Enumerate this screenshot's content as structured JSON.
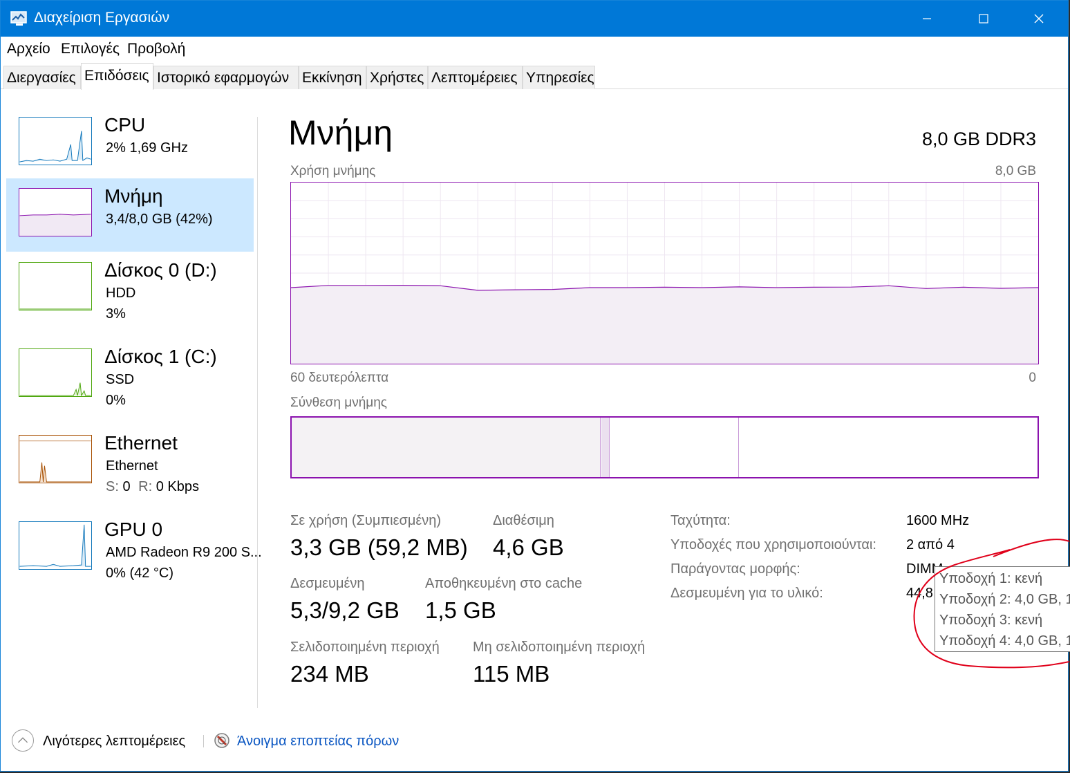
{
  "window": {
    "title": "Διαχείριση Εργασιών"
  },
  "menu": [
    "Αρχείο",
    "Επιλογές",
    "Προβολή"
  ],
  "tabs": [
    "Διεργασίες",
    "Επιδόσεις",
    "Ιστορικό εφαρμογών",
    "Εκκίνηση",
    "Χρήστες",
    "Λεπτομέρειες",
    "Υπηρεσίες"
  ],
  "active_tab": "Επιδόσεις",
  "sidebar": [
    {
      "title": "CPU",
      "line1": "2%  1,69 GHz",
      "line2": "",
      "color": "#1177bb"
    },
    {
      "title": "Μνήμη",
      "line1": "3,4/8,0 GB (42%)",
      "line2": "",
      "color": "#8b12ae"
    },
    {
      "title": "Δίσκος 0 (D:)",
      "line1": "HDD",
      "line2": "3%",
      "color": "#4da60c"
    },
    {
      "title": "Δίσκος 1 (C:)",
      "line1": "SSD",
      "line2": "0%",
      "color": "#4da60c"
    },
    {
      "title": "Ethernet",
      "line1": "Ethernet",
      "line2_label_s": "S:",
      "line2_s": "0",
      "line2_label_r": "R:",
      "line2_r": "0 Kbps",
      "color": "#a74f01"
    },
    {
      "title": "GPU 0",
      "line1": "AMD Radeon R9 200 S...",
      "line2": "0%  (42 °C)",
      "color": "#1177bb"
    }
  ],
  "main": {
    "title": "Μνήμη",
    "spec": "8,0 GB DDR3",
    "usage_label": "Χρήση μνήμης",
    "usage_max": "8,0 GB",
    "time_left": "60 δευτερόλεπτα",
    "time_right": "0",
    "composition_label": "Σύνθεση μνήμης",
    "usage_fraction": 0.42,
    "stats": {
      "in_use_label": "Σε χρήση (Συμπιεσμένη)",
      "in_use_value": "3,3 GB (59,2 MB)",
      "available_label": "Διαθέσιμη",
      "available_value": "4,6 GB",
      "committed_label": "Δεσμευμένη",
      "committed_value": "5,3/9,2 GB",
      "cached_label": "Αποθηκευμένη στο cache",
      "cached_value": "1,5 GB",
      "paged_label": "Σελιδοποιημένη περιοχή",
      "paged_value": "234 MB",
      "nonpaged_label": "Μη σελιδοποιημένη περιοχή",
      "nonpaged_value": "115 MB"
    },
    "info": [
      {
        "label": "Ταχύτητα:",
        "value": "1600 MHz"
      },
      {
        "label": "Υποδοχές που χρησιμοποιούνται:",
        "value": "2 από 4"
      },
      {
        "label": "Παράγοντας μορφής:",
        "value": "DIMM"
      },
      {
        "label": "Δεσμευμένη για το υλικό:",
        "value": "44,8"
      }
    ],
    "tooltip": [
      "Υποδοχή 1: κενή",
      "Υποδοχή 2: 4,0 GB, 1",
      "Υποδοχή 3: κενή",
      "Υποδοχή 4: 4,0 GB, 1"
    ]
  },
  "footer": {
    "fewer_details": "Λιγότερες λεπτομέρειες",
    "resource_monitor": "Άνοιγμα εποπτείας πόρων"
  },
  "colors": {
    "accent": "#0078d7",
    "memory": "#8b12ae",
    "selected": "#cce8ff",
    "annotation": "#e0001a"
  },
  "icons": [
    "task-manager-icon",
    "minimize-icon",
    "maximize-icon",
    "close-icon",
    "collapse-chevron-icon",
    "resource-monitor-icon"
  ]
}
